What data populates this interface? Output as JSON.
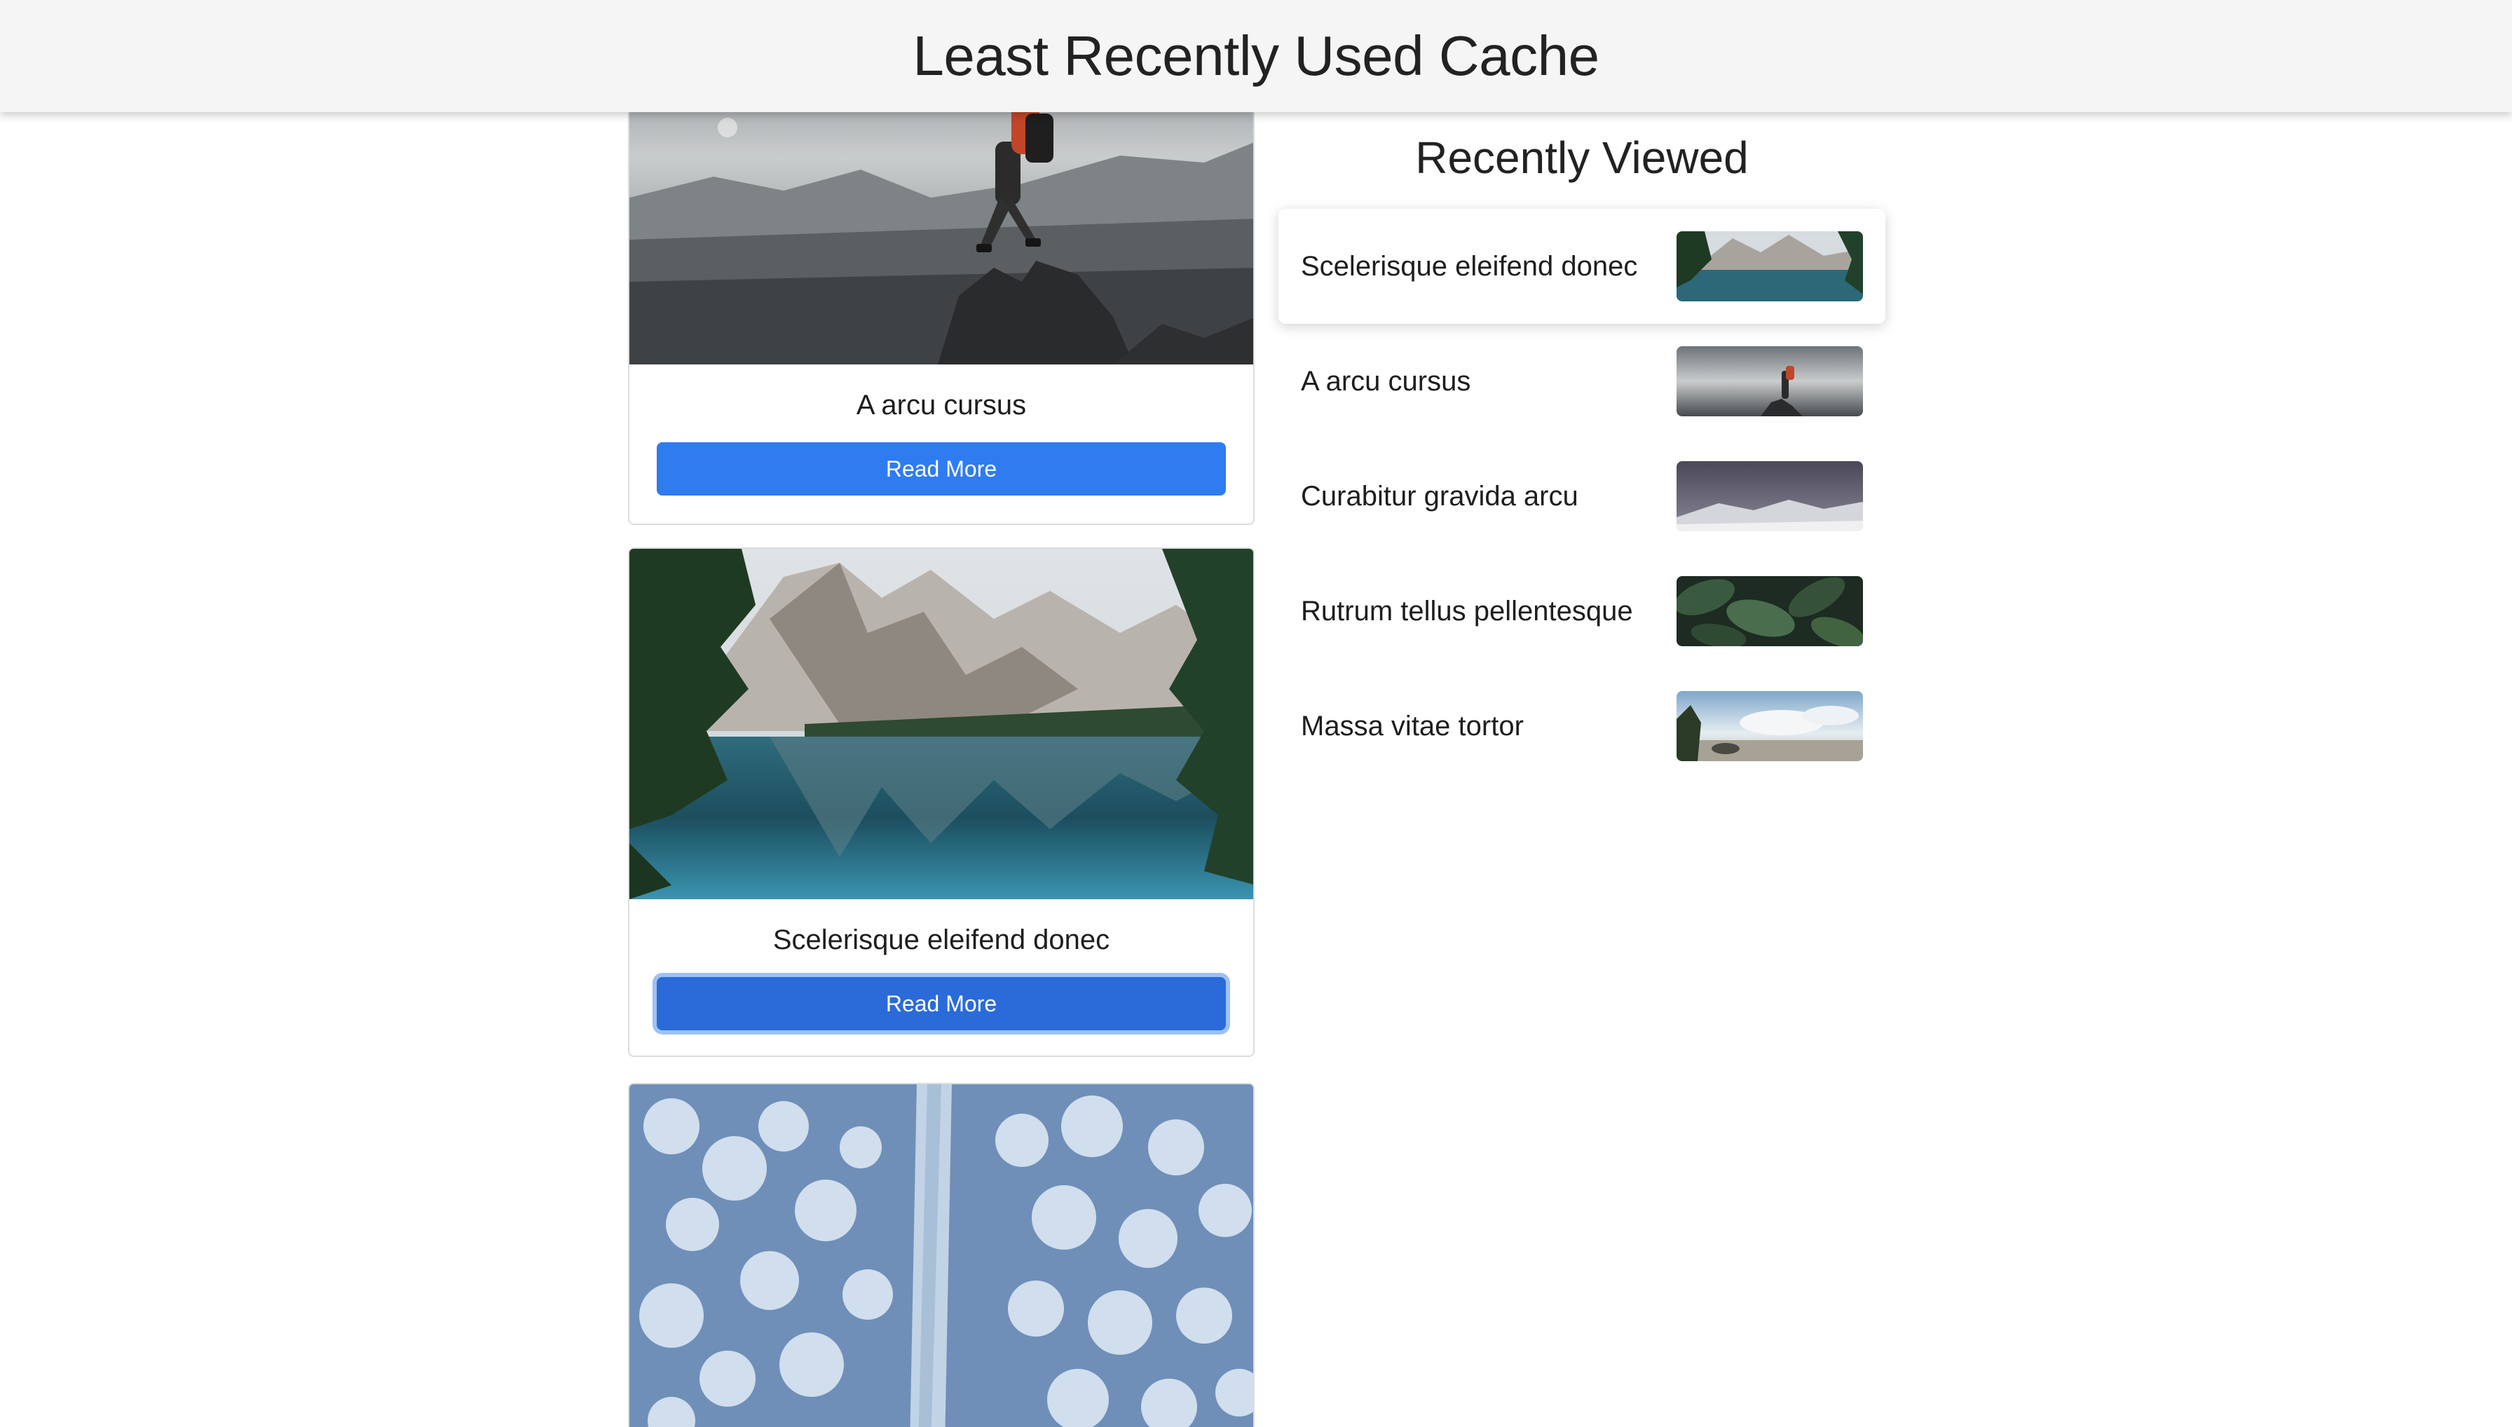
{
  "header": {
    "title": "Least Recently Used Cache"
  },
  "cards": [
    {
      "title": "A arcu cursus",
      "button": "Read More",
      "image": "hiker-on-rock"
    },
    {
      "title": "Scelerisque eleifend donec",
      "button": "Read More",
      "image": "mountain-lake"
    },
    {
      "title": "",
      "button": "",
      "image": "snowy-forest-road"
    }
  ],
  "recently_viewed": {
    "title": "Recently Viewed",
    "items": [
      {
        "label": "Scelerisque eleifend donec",
        "thumb": "mountain-lake"
      },
      {
        "label": "A arcu cursus",
        "thumb": "hiker-on-rock"
      },
      {
        "label": "Curabitur gravida arcu",
        "thumb": "snowy-mountain-night"
      },
      {
        "label": "Rutrum tellus pellentesque",
        "thumb": "green-leaves"
      },
      {
        "label": "Massa vitae tortor",
        "thumb": "tropical-beach"
      }
    ]
  },
  "colors": {
    "primary_button": "#2e7cf0",
    "header_bg": "#f5f5f5"
  }
}
